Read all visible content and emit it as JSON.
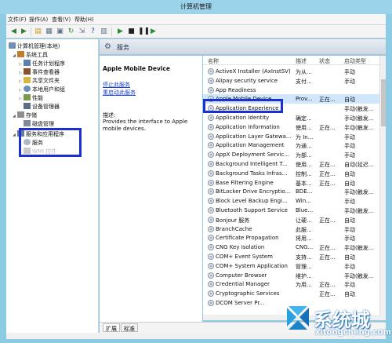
{
  "window": {
    "title": "计算机管理"
  },
  "menu": [
    {
      "label": "文件(F)"
    },
    {
      "label": "操作(A)"
    },
    {
      "label": "查看(V)"
    },
    {
      "label": "帮助(H)"
    }
  ],
  "tree": {
    "root": "计算机管理(本地)",
    "system_tools": "系统工具",
    "task_scheduler": "任务计划程序",
    "event_viewer": "事件查看器",
    "shared_folders": "共享文件夹",
    "local_users": "本地用户和组",
    "performance": "性能",
    "device_manager": "设备管理器",
    "storage": "存储",
    "disk_management": "磁盘管理",
    "services_apps": "服务和应用程序",
    "services": "服务",
    "wmi": "WMI 控件"
  },
  "header": {
    "label": "服务"
  },
  "desc": {
    "title": "Apple Mobile Device",
    "stop_link": "停止此服务",
    "restart_link": "重启动此服务",
    "desc_label": "描述:",
    "desc_text": "Provides the interface to Apple mobile devices."
  },
  "list": {
    "columns": [
      "名称",
      "描述",
      "状态",
      "启动类型"
    ],
    "rows": [
      {
        "name": "ActiveX Installer (AxInstSV)",
        "desc": "为从...",
        "status": "",
        "startup": "手动"
      },
      {
        "name": "Alipay security service",
        "desc": "支付...",
        "status": "",
        "startup": "手动"
      },
      {
        "name": "App Readiness",
        "desc": "",
        "status": "",
        "startup": ""
      },
      {
        "name": "Apple Mobile Device",
        "desc": "Prov...",
        "status": "正在...",
        "startup": "自动",
        "selected": true
      },
      {
        "name": "Application Experience",
        "desc": "",
        "status": "",
        "startup": "手动(触发..."
      },
      {
        "name": "Application Identity",
        "desc": "确定...",
        "status": "",
        "startup": "手动(触发..."
      },
      {
        "name": "Application Information",
        "desc": "使用...",
        "status": "正在...",
        "startup": "手动(触发..."
      },
      {
        "name": "Application Layer Gatewa...",
        "desc": "为 In...",
        "status": "",
        "startup": "手动"
      },
      {
        "name": "Application Management",
        "desc": "为通...",
        "status": "",
        "startup": "手动"
      },
      {
        "name": "AppX Deployment Servic...",
        "desc": "为部...",
        "status": "",
        "startup": "手动"
      },
      {
        "name": "Background Intelligent T...",
        "desc": "使用...",
        "status": "正在...",
        "startup": "自动(延迟..."
      },
      {
        "name": "Background Tasks Infras...",
        "desc": "控制...",
        "status": "正在...",
        "startup": "自动"
      },
      {
        "name": "Base Filtering Engine",
        "desc": "基本...",
        "status": "正在...",
        "startup": "自动"
      },
      {
        "name": "BitLocker Drive Encryptio...",
        "desc": "BDE...",
        "status": "",
        "startup": "手动(触发..."
      },
      {
        "name": "Block Level Backup Engi...",
        "desc": "Win...",
        "status": "",
        "startup": "手动"
      },
      {
        "name": "Bluetooth Support Service",
        "desc": "Blue...",
        "status": "",
        "startup": "手动(触发..."
      },
      {
        "name": "Bonjour 服务",
        "desc": "让硬...",
        "status": "正在...",
        "startup": "自动"
      },
      {
        "name": "BranchCache",
        "desc": "此服...",
        "status": "",
        "startup": "手动"
      },
      {
        "name": "Certificate Propagation",
        "desc": "将用...",
        "status": "",
        "startup": "手动"
      },
      {
        "name": "CNG Key Isolation",
        "desc": "CNG...",
        "status": "正在...",
        "startup": "手动(触发..."
      },
      {
        "name": "COM+ Event System",
        "desc": "支持...",
        "status": "正在...",
        "startup": "自动"
      },
      {
        "name": "COM+ System Application",
        "desc": "管理...",
        "status": "",
        "startup": "手动"
      },
      {
        "name": "Computer Browser",
        "desc": "维护...",
        "status": "",
        "startup": "手动(触发..."
      },
      {
        "name": "Credential Manager",
        "desc": "为用...",
        "status": "正在...",
        "startup": "手动"
      },
      {
        "name": "Cryptographic Services",
        "desc": "",
        "status": "正在...",
        "startup": "自动"
      },
      {
        "name": "DCOM Server Pr...",
        "desc": "",
        "status": "",
        "startup": ""
      }
    ]
  },
  "tabs": {
    "extended": "扩展",
    "standard": "标准"
  },
  "watermark": {
    "brand": "系统城",
    "url": "xitongcheng.com"
  }
}
